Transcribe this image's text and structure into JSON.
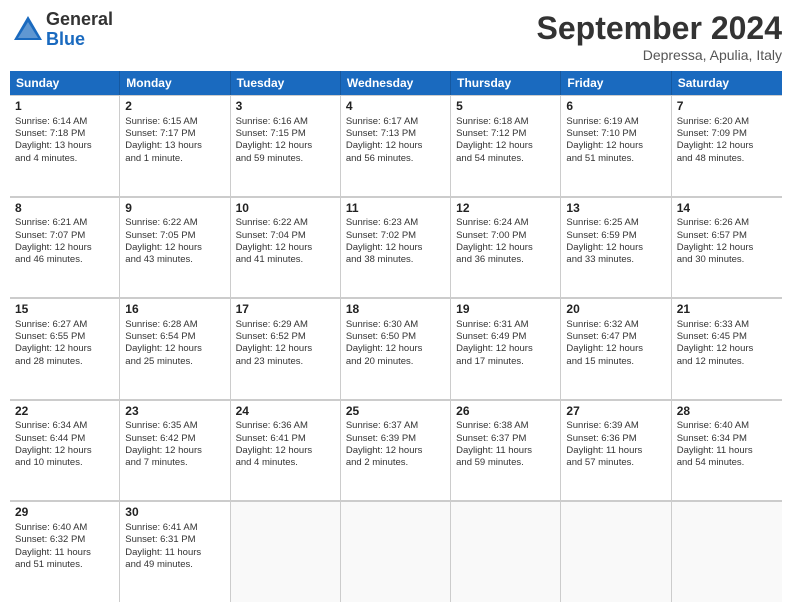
{
  "logo": {
    "general": "General",
    "blue": "Blue"
  },
  "header": {
    "month": "September 2024",
    "location": "Depressa, Apulia, Italy"
  },
  "days": [
    "Sunday",
    "Monday",
    "Tuesday",
    "Wednesday",
    "Thursday",
    "Friday",
    "Saturday"
  ],
  "weeks": [
    [
      {
        "day": 1,
        "info": "Sunrise: 6:14 AM\nSunset: 7:18 PM\nDaylight: 13 hours\nand 4 minutes."
      },
      {
        "day": 2,
        "info": "Sunrise: 6:15 AM\nSunset: 7:17 PM\nDaylight: 13 hours\nand 1 minute."
      },
      {
        "day": 3,
        "info": "Sunrise: 6:16 AM\nSunset: 7:15 PM\nDaylight: 12 hours\nand 59 minutes."
      },
      {
        "day": 4,
        "info": "Sunrise: 6:17 AM\nSunset: 7:13 PM\nDaylight: 12 hours\nand 56 minutes."
      },
      {
        "day": 5,
        "info": "Sunrise: 6:18 AM\nSunset: 7:12 PM\nDaylight: 12 hours\nand 54 minutes."
      },
      {
        "day": 6,
        "info": "Sunrise: 6:19 AM\nSunset: 7:10 PM\nDaylight: 12 hours\nand 51 minutes."
      },
      {
        "day": 7,
        "info": "Sunrise: 6:20 AM\nSunset: 7:09 PM\nDaylight: 12 hours\nand 48 minutes."
      }
    ],
    [
      {
        "day": 8,
        "info": "Sunrise: 6:21 AM\nSunset: 7:07 PM\nDaylight: 12 hours\nand 46 minutes."
      },
      {
        "day": 9,
        "info": "Sunrise: 6:22 AM\nSunset: 7:05 PM\nDaylight: 12 hours\nand 43 minutes."
      },
      {
        "day": 10,
        "info": "Sunrise: 6:22 AM\nSunset: 7:04 PM\nDaylight: 12 hours\nand 41 minutes."
      },
      {
        "day": 11,
        "info": "Sunrise: 6:23 AM\nSunset: 7:02 PM\nDaylight: 12 hours\nand 38 minutes."
      },
      {
        "day": 12,
        "info": "Sunrise: 6:24 AM\nSunset: 7:00 PM\nDaylight: 12 hours\nand 36 minutes."
      },
      {
        "day": 13,
        "info": "Sunrise: 6:25 AM\nSunset: 6:59 PM\nDaylight: 12 hours\nand 33 minutes."
      },
      {
        "day": 14,
        "info": "Sunrise: 6:26 AM\nSunset: 6:57 PM\nDaylight: 12 hours\nand 30 minutes."
      }
    ],
    [
      {
        "day": 15,
        "info": "Sunrise: 6:27 AM\nSunset: 6:55 PM\nDaylight: 12 hours\nand 28 minutes."
      },
      {
        "day": 16,
        "info": "Sunrise: 6:28 AM\nSunset: 6:54 PM\nDaylight: 12 hours\nand 25 minutes."
      },
      {
        "day": 17,
        "info": "Sunrise: 6:29 AM\nSunset: 6:52 PM\nDaylight: 12 hours\nand 23 minutes."
      },
      {
        "day": 18,
        "info": "Sunrise: 6:30 AM\nSunset: 6:50 PM\nDaylight: 12 hours\nand 20 minutes."
      },
      {
        "day": 19,
        "info": "Sunrise: 6:31 AM\nSunset: 6:49 PM\nDaylight: 12 hours\nand 17 minutes."
      },
      {
        "day": 20,
        "info": "Sunrise: 6:32 AM\nSunset: 6:47 PM\nDaylight: 12 hours\nand 15 minutes."
      },
      {
        "day": 21,
        "info": "Sunrise: 6:33 AM\nSunset: 6:45 PM\nDaylight: 12 hours\nand 12 minutes."
      }
    ],
    [
      {
        "day": 22,
        "info": "Sunrise: 6:34 AM\nSunset: 6:44 PM\nDaylight: 12 hours\nand 10 minutes."
      },
      {
        "day": 23,
        "info": "Sunrise: 6:35 AM\nSunset: 6:42 PM\nDaylight: 12 hours\nand 7 minutes."
      },
      {
        "day": 24,
        "info": "Sunrise: 6:36 AM\nSunset: 6:41 PM\nDaylight: 12 hours\nand 4 minutes."
      },
      {
        "day": 25,
        "info": "Sunrise: 6:37 AM\nSunset: 6:39 PM\nDaylight: 12 hours\nand 2 minutes."
      },
      {
        "day": 26,
        "info": "Sunrise: 6:38 AM\nSunset: 6:37 PM\nDaylight: 11 hours\nand 59 minutes."
      },
      {
        "day": 27,
        "info": "Sunrise: 6:39 AM\nSunset: 6:36 PM\nDaylight: 11 hours\nand 57 minutes."
      },
      {
        "day": 28,
        "info": "Sunrise: 6:40 AM\nSunset: 6:34 PM\nDaylight: 11 hours\nand 54 minutes."
      }
    ],
    [
      {
        "day": 29,
        "info": "Sunrise: 6:40 AM\nSunset: 6:32 PM\nDaylight: 11 hours\nand 51 minutes."
      },
      {
        "day": 30,
        "info": "Sunrise: 6:41 AM\nSunset: 6:31 PM\nDaylight: 11 hours\nand 49 minutes."
      },
      null,
      null,
      null,
      null,
      null
    ]
  ]
}
